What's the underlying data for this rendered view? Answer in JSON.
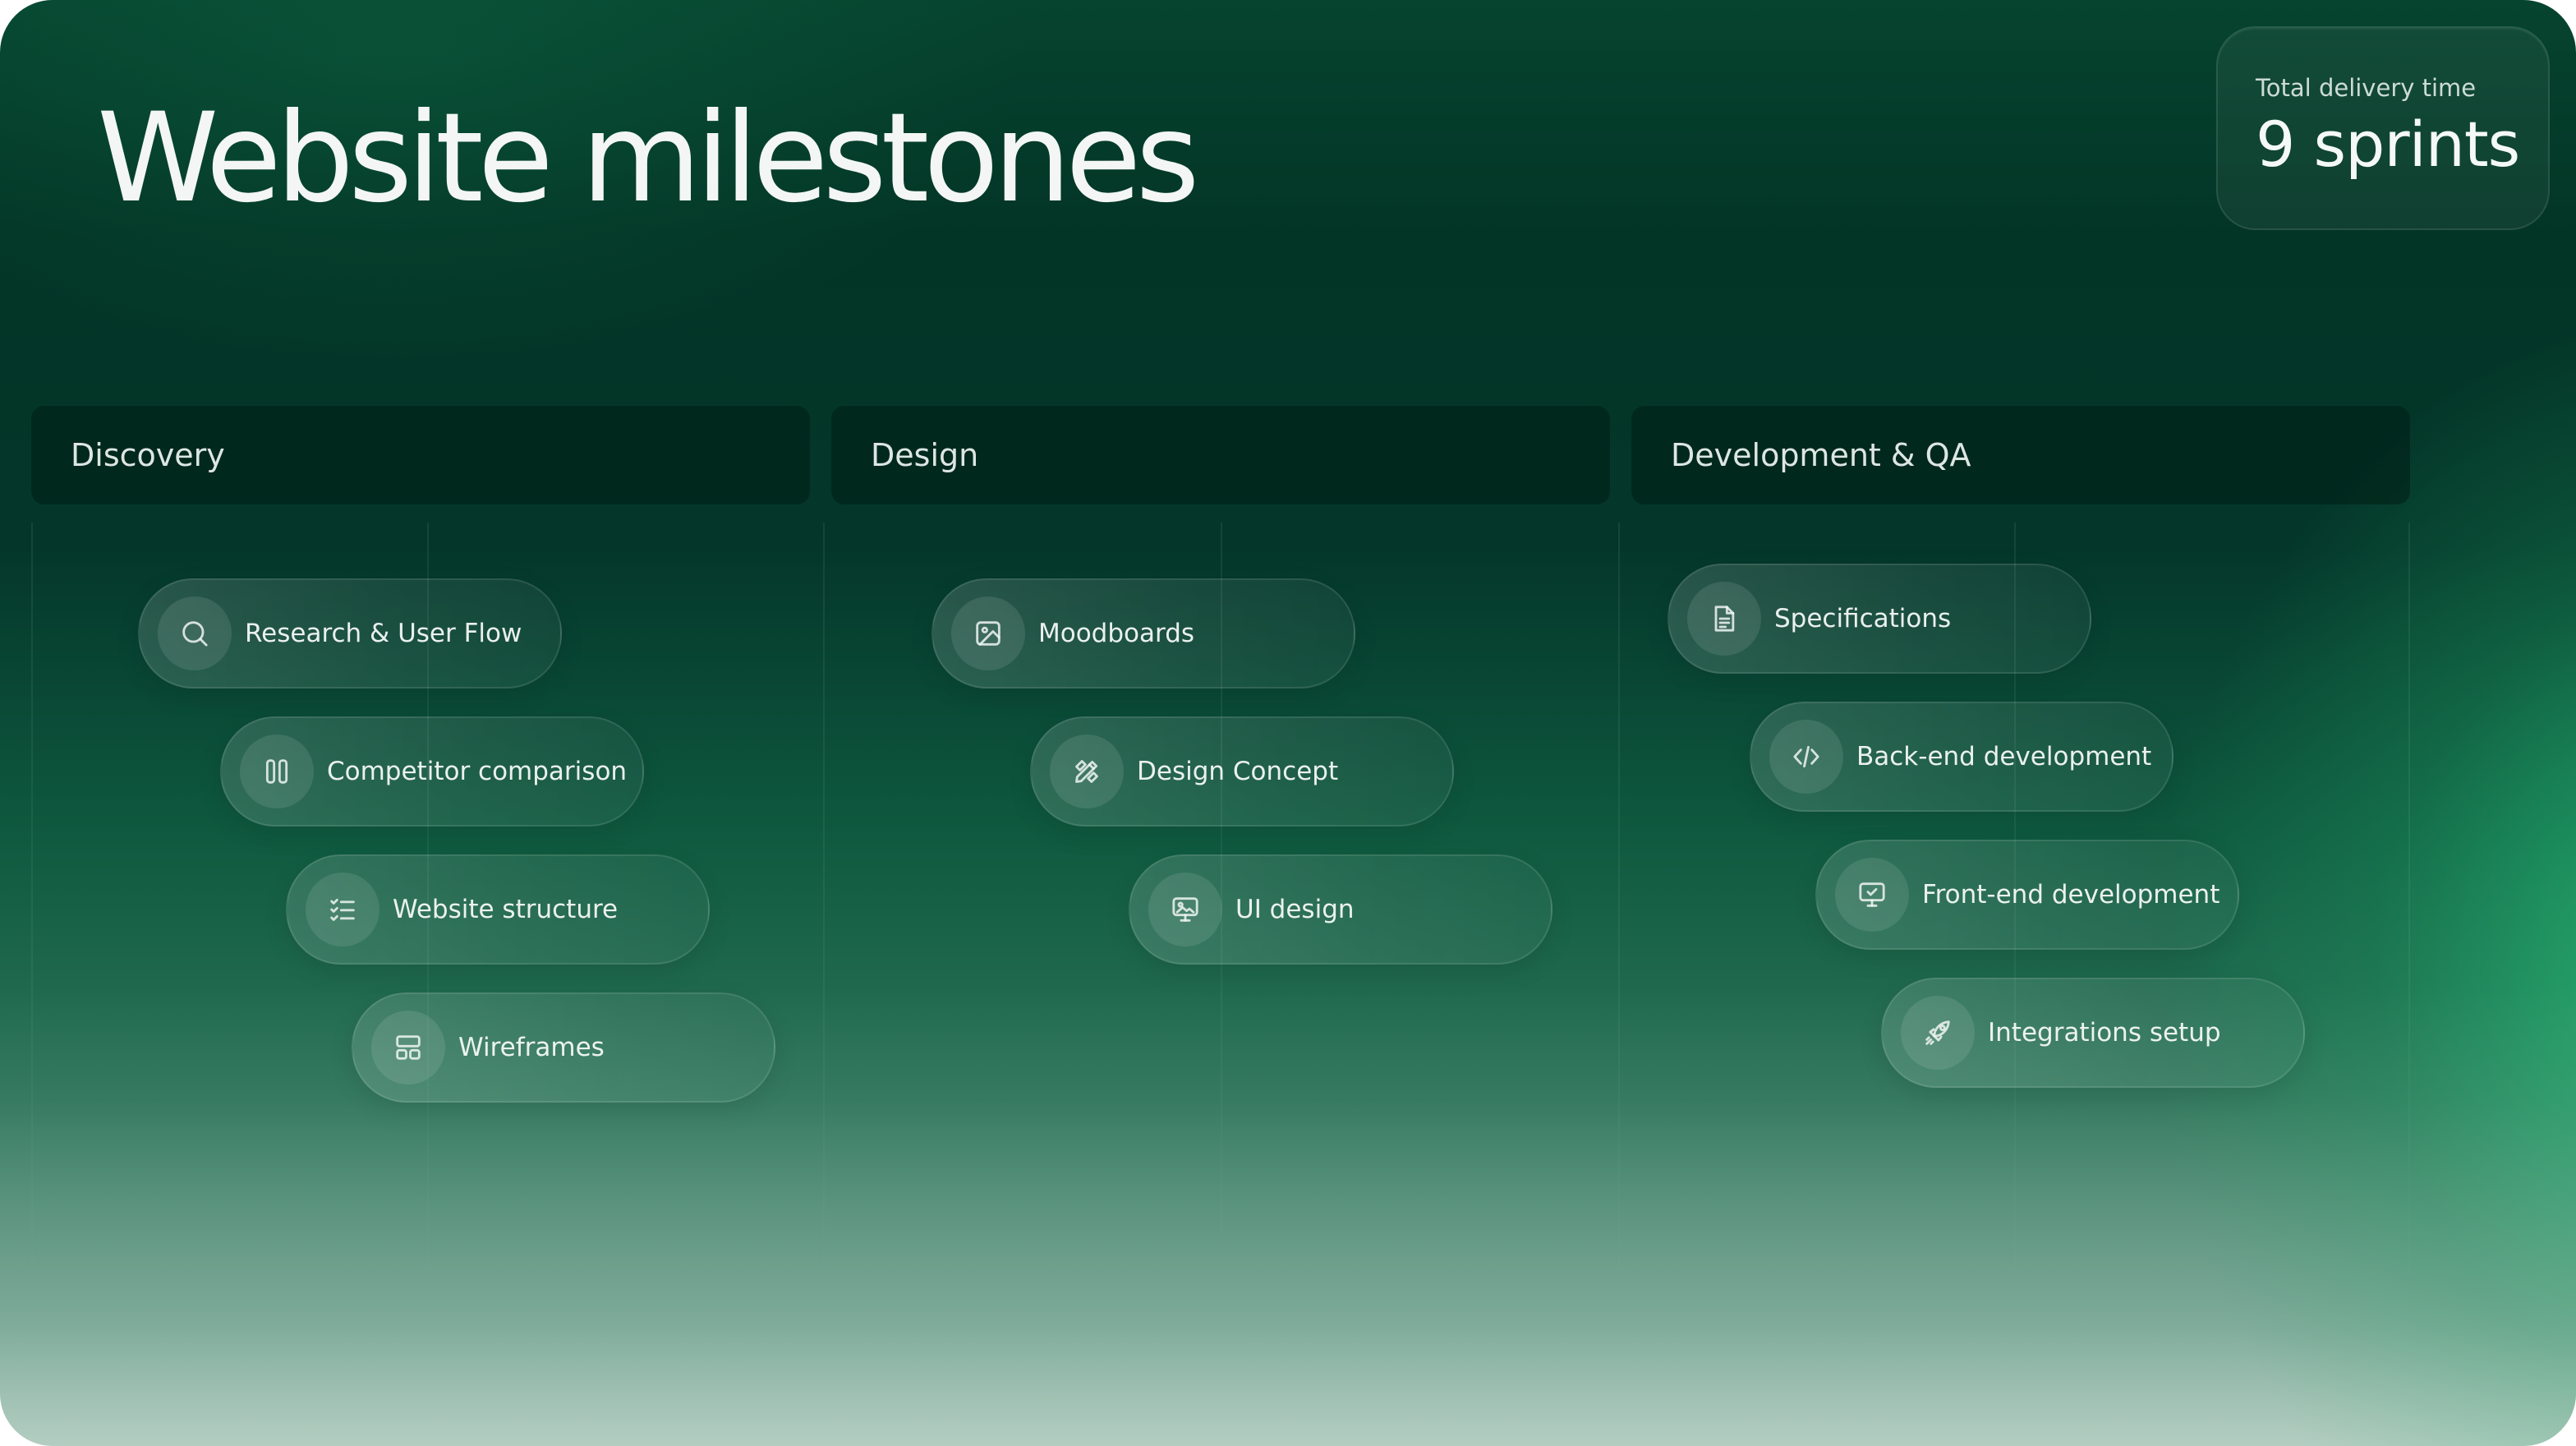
{
  "slide": {
    "title": "Website milestones",
    "delivery": {
      "label": "Total delivery time",
      "value": "9 sprints"
    }
  },
  "phases": [
    {
      "name": "Discovery",
      "tasks": [
        {
          "label": "Research & User Flow",
          "icon": "search-icon"
        },
        {
          "label": "Competitor comparison",
          "icon": "columns-icon"
        },
        {
          "label": "Website structure",
          "icon": "checklist-icon"
        },
        {
          "label": "Wireframes",
          "icon": "layout-icon"
        }
      ]
    },
    {
      "name": "Design",
      "tasks": [
        {
          "label": "Moodboards",
          "icon": "image-icon"
        },
        {
          "label": "Design Concept",
          "icon": "pencil-ruler-icon"
        },
        {
          "label": "UI design",
          "icon": "monitor-image-icon"
        }
      ]
    },
    {
      "name": "Development & QA",
      "tasks": [
        {
          "label": "Specifications",
          "icon": "document-icon"
        },
        {
          "label": "Back-end development",
          "icon": "code-icon"
        },
        {
          "label": "Front-end development",
          "icon": "monitor-check-icon"
        },
        {
          "label": "Integrations setup",
          "icon": "rocket-icon"
        }
      ]
    }
  ]
}
